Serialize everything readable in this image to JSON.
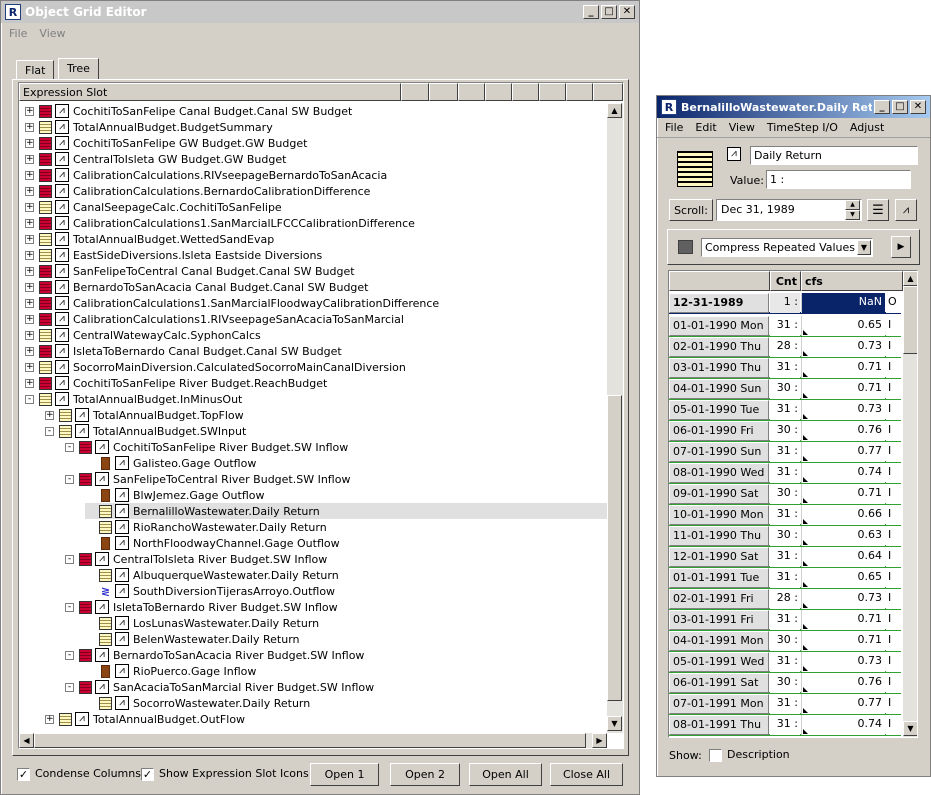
{
  "grid_editor": {
    "title": "Object Grid Editor",
    "menu": [
      "File",
      "View"
    ],
    "tabs": [
      "Flat",
      "Tree"
    ],
    "column_header": "Expression Slot",
    "tree": [
      {
        "indent": 0,
        "exp": "+",
        "icon": "red",
        "label": "CochitiToSanFelipe Canal Budget.Canal SW Budget"
      },
      {
        "indent": 0,
        "exp": "+",
        "icon": "yel",
        "label": "TotalAnnualBudget.BudgetSummary"
      },
      {
        "indent": 0,
        "exp": "+",
        "icon": "red",
        "label": "CochitiToSanFelipe GW Budget.GW Budget"
      },
      {
        "indent": 0,
        "exp": "+",
        "icon": "red",
        "label": "CentralToIsleta GW Budget.GW Budget"
      },
      {
        "indent": 0,
        "exp": "+",
        "icon": "red",
        "label": "CalibrationCalculations.RIVseepageBernardoToSanAcacia"
      },
      {
        "indent": 0,
        "exp": "+",
        "icon": "red",
        "label": "CalibrationCalculations.BernardoCalibrationDifference"
      },
      {
        "indent": 0,
        "exp": "+",
        "icon": "yel",
        "label": "CanalSeepageCalc.CochitiToSanFelipe"
      },
      {
        "indent": 0,
        "exp": "+",
        "icon": "red",
        "label": "CalibrationCalculations1.SanMarcialLFCCCalibrationDifference"
      },
      {
        "indent": 0,
        "exp": "+",
        "icon": "yel",
        "label": "TotalAnnualBudget.WettedSandEvap"
      },
      {
        "indent": 0,
        "exp": "+",
        "icon": "yel",
        "label": "EastSideDiversions.Isleta Eastside Diversions"
      },
      {
        "indent": 0,
        "exp": "+",
        "icon": "red",
        "label": "SanFelipeToCentral Canal Budget.Canal SW Budget"
      },
      {
        "indent": 0,
        "exp": "+",
        "icon": "red",
        "label": "BernardoToSanAcacia Canal Budget.Canal SW Budget"
      },
      {
        "indent": 0,
        "exp": "+",
        "icon": "red",
        "label": "CalibrationCalculations1.SanMarcialFloodwayCalibrationDifference"
      },
      {
        "indent": 0,
        "exp": "+",
        "icon": "red",
        "label": "CalibrationCalculations1.RIVseepageSanAcaciaToSanMarcial"
      },
      {
        "indent": 0,
        "exp": "+",
        "icon": "yel",
        "label": "CentralWatewayCalc.SyphonCalcs"
      },
      {
        "indent": 0,
        "exp": "+",
        "icon": "red",
        "label": "IsletaToBernardo Canal Budget.Canal SW Budget"
      },
      {
        "indent": 0,
        "exp": "+",
        "icon": "yel",
        "label": "SocorroMainDiversion.CalculatedSocorroMainCanalDiversion"
      },
      {
        "indent": 0,
        "exp": "+",
        "icon": "red",
        "label": "CochitiToSanFelipe River Budget.ReachBudget"
      },
      {
        "indent": 0,
        "exp": "-",
        "icon": "yel",
        "label": "TotalAnnualBudget.InMinusOut"
      },
      {
        "indent": 1,
        "exp": "+",
        "icon": "yel",
        "label": "TotalAnnualBudget.TopFlow"
      },
      {
        "indent": 1,
        "exp": "-",
        "icon": "yel",
        "label": "TotalAnnualBudget.SWInput"
      },
      {
        "indent": 2,
        "exp": "-",
        "icon": "red",
        "label": "CochitiToSanFelipe River Budget.SW Inflow"
      },
      {
        "indent": 3,
        "exp": "",
        "icon": "obj",
        "label": "Galisteo.Gage Outflow"
      },
      {
        "indent": 2,
        "exp": "-",
        "icon": "red",
        "label": "SanFelipeToCentral River Budget.SW Inflow"
      },
      {
        "indent": 3,
        "exp": "",
        "icon": "obj",
        "label": "BlwJemez.Gage Outflow"
      },
      {
        "indent": 3,
        "exp": "",
        "icon": "yel",
        "label": "BernalilloWastewater.Daily Return",
        "selected": true
      },
      {
        "indent": 3,
        "exp": "",
        "icon": "yel",
        "label": "RioRanchoWastewater.Daily Return"
      },
      {
        "indent": 3,
        "exp": "",
        "icon": "obj",
        "label": "NorthFloodwayChannel.Gage Outflow"
      },
      {
        "indent": 2,
        "exp": "-",
        "icon": "red",
        "label": "CentralToIsleta River Budget.SW Inflow"
      },
      {
        "indent": 3,
        "exp": "",
        "icon": "yel",
        "label": "AlbuquerqueWastewater.Daily Return"
      },
      {
        "indent": 3,
        "exp": "",
        "icon": "canal",
        "label": "SouthDiversionTijerasArroyo.Outflow"
      },
      {
        "indent": 2,
        "exp": "-",
        "icon": "red",
        "label": "IsletaToBernardo River Budget.SW Inflow"
      },
      {
        "indent": 3,
        "exp": "",
        "icon": "yel",
        "label": "LosLunasWastewater.Daily Return"
      },
      {
        "indent": 3,
        "exp": "",
        "icon": "yel",
        "label": "BelenWastewater.Daily Return"
      },
      {
        "indent": 2,
        "exp": "-",
        "icon": "red",
        "label": "BernardoToSanAcacia River Budget.SW Inflow"
      },
      {
        "indent": 3,
        "exp": "",
        "icon": "obj",
        "label": "RioPuerco.Gage Inflow"
      },
      {
        "indent": 2,
        "exp": "-",
        "icon": "red",
        "label": "SanAcaciaToSanMarcial River Budget.SW Inflow"
      },
      {
        "indent": 3,
        "exp": "",
        "icon": "yel",
        "label": "SocorroWastewater.Daily Return"
      },
      {
        "indent": 1,
        "exp": "+",
        "icon": "yel",
        "label": "TotalAnnualBudget.OutFlow"
      }
    ],
    "condense_columns": "Condense Columns",
    "show_icons": "Show Expression Slot Icons",
    "open1": "Open 1",
    "open2": "Open 2",
    "open_all": "Open All",
    "close_all": "Close All"
  },
  "slot_dialog": {
    "title": "BernalilloWastewater.Daily Return",
    "menu": [
      "File",
      "Edit",
      "View",
      "TimeStep I/O",
      "Adjust"
    ],
    "slot_name": "Daily Return",
    "value_label": "Value:",
    "value": "1 :",
    "scroll_label": "Scroll:",
    "scroll_date": "Dec 31, 1989",
    "compress_option": "Compress Repeated Values",
    "col_cnt": "Cnt",
    "col_units": "cfs",
    "rows": [
      {
        "date": "12-31-1989 Sun",
        "cnt": "1 :",
        "val": "NaN",
        "flag": "O",
        "current": true
      },
      {
        "date": "01-01-1990 Mon",
        "cnt": "31 :",
        "val": "0.65",
        "flag": "I"
      },
      {
        "date": "02-01-1990 Thu",
        "cnt": "28 :",
        "val": "0.73",
        "flag": "I"
      },
      {
        "date": "03-01-1990 Thu",
        "cnt": "31 :",
        "val": "0.71",
        "flag": "I"
      },
      {
        "date": "04-01-1990 Sun",
        "cnt": "30 :",
        "val": "0.71",
        "flag": "I"
      },
      {
        "date": "05-01-1990 Tue",
        "cnt": "31 :",
        "val": "0.73",
        "flag": "I"
      },
      {
        "date": "06-01-1990 Fri",
        "cnt": "30 :",
        "val": "0.76",
        "flag": "I"
      },
      {
        "date": "07-01-1990 Sun",
        "cnt": "31 :",
        "val": "0.77",
        "flag": "I"
      },
      {
        "date": "08-01-1990 Wed",
        "cnt": "31 :",
        "val": "0.74",
        "flag": "I"
      },
      {
        "date": "09-01-1990 Sat",
        "cnt": "30 :",
        "val": "0.71",
        "flag": "I"
      },
      {
        "date": "10-01-1990 Mon",
        "cnt": "31 :",
        "val": "0.66",
        "flag": "I"
      },
      {
        "date": "11-01-1990 Thu",
        "cnt": "30 :",
        "val": "0.63",
        "flag": "I"
      },
      {
        "date": "12-01-1990 Sat",
        "cnt": "31 :",
        "val": "0.64",
        "flag": "I"
      },
      {
        "date": "01-01-1991 Tue",
        "cnt": "31 :",
        "val": "0.65",
        "flag": "I"
      },
      {
        "date": "02-01-1991 Fri",
        "cnt": "28 :",
        "val": "0.73",
        "flag": "I"
      },
      {
        "date": "03-01-1991 Fri",
        "cnt": "31 :",
        "val": "0.71",
        "flag": "I"
      },
      {
        "date": "04-01-1991 Mon",
        "cnt": "30 :",
        "val": "0.71",
        "flag": "I"
      },
      {
        "date": "05-01-1991 Wed",
        "cnt": "31 :",
        "val": "0.73",
        "flag": "I"
      },
      {
        "date": "06-01-1991 Sat",
        "cnt": "30 :",
        "val": "0.76",
        "flag": "I"
      },
      {
        "date": "07-01-1991 Mon",
        "cnt": "31 :",
        "val": "0.77",
        "flag": "I"
      },
      {
        "date": "08-01-1991 Thu",
        "cnt": "31 :",
        "val": "0.74",
        "flag": "I"
      }
    ],
    "show_label": "Show:",
    "description_label": "Description"
  }
}
